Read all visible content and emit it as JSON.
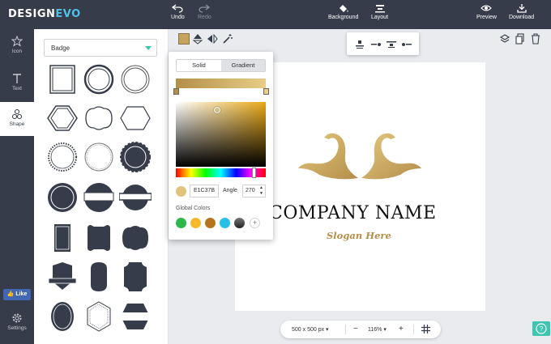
{
  "app": {
    "logo_main": "DESIGN",
    "logo_accent": "EVO"
  },
  "toolbar": {
    "undo": "Undo",
    "redo": "Redo",
    "background": "Background",
    "layout": "Layout",
    "preview": "Preview",
    "download": "Download"
  },
  "rail": {
    "items": [
      {
        "label": "Icon",
        "icon": "star-icon"
      },
      {
        "label": "Text",
        "icon": "text-icon"
      },
      {
        "label": "Shape",
        "icon": "shapes-icon",
        "active": true
      }
    ],
    "like": "Like",
    "settings": "Settings"
  },
  "shape_panel": {
    "category": "Badge"
  },
  "color_popup": {
    "tabs": [
      "Solid",
      "Gradient"
    ],
    "selected_tab": "Gradient",
    "gradient_start": "#b38f48",
    "gradient_end": "#e8cd86",
    "hex_value": "E1C37B",
    "angle_label": "Angle",
    "angle_value": "270",
    "global_colors_label": "Global Colors",
    "global_colors": [
      "#2eb84b",
      "#f5b92a",
      "#b5741e",
      "#2ac0e6",
      "#333a45"
    ],
    "add_symbol": "+"
  },
  "canvas": {
    "company_name": "COMPANY NAME",
    "slogan": "Slogan Here",
    "logo_color": "#c9a55b"
  },
  "zoom_bar": {
    "size": "500 x 500 px",
    "minus": "−",
    "zoom": "116%",
    "plus": "+"
  },
  "colors": {
    "topbar": "#363c49",
    "accent": "#3ec6b0",
    "brand_accent": "#4fc1e9"
  }
}
